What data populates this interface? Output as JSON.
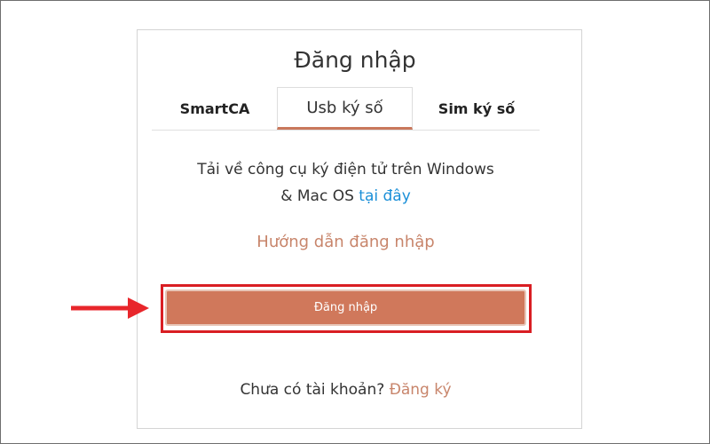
{
  "login": {
    "title": "Đăng nhập",
    "tabs": [
      {
        "label": "SmartCA",
        "active": false
      },
      {
        "label": "Usb ký số",
        "active": true
      },
      {
        "label": "Sim ký số",
        "active": false
      }
    ],
    "description_line1": "Tải về công cụ ký điện tử trên Windows",
    "description_line2": "& Mac OS",
    "download_link": "tại đây",
    "guide_link": "Hướng dẫn đăng nhập",
    "login_button": "Đăng nhập",
    "no_account_text": "Chưa có tài khoản?",
    "register_link": "Đăng ký"
  },
  "annotations": {
    "arrow_icon": "right-arrow-icon",
    "highlight_color": "#d91e23"
  },
  "colors": {
    "accent": "#d0785b",
    "link": "#1a8fd8",
    "guide_link": "#c8856b"
  }
}
